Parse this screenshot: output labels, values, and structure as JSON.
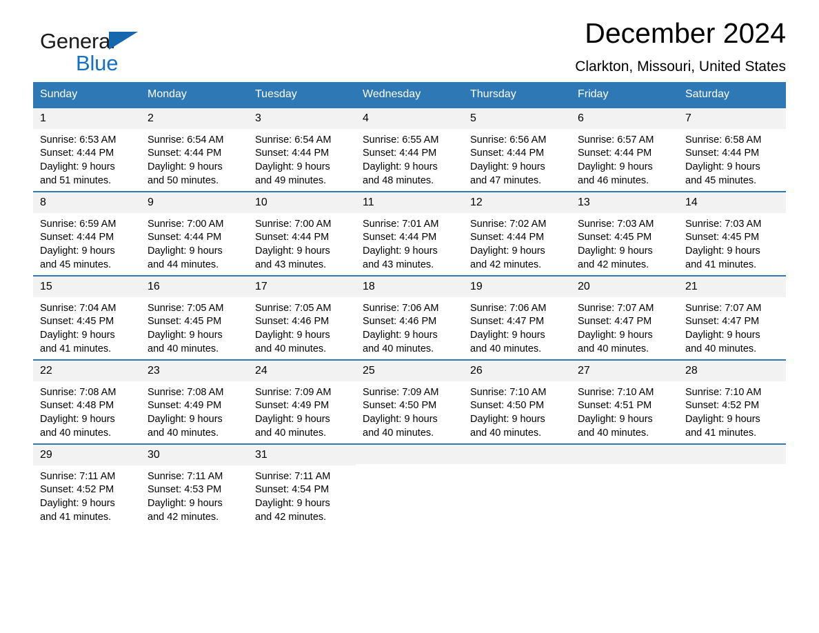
{
  "brand": {
    "name_part1": "General",
    "name_part2": "Blue",
    "accent_color": "#1271c4",
    "triangle_color": "#1567ae"
  },
  "header": {
    "title": "December 2024",
    "location": "Clarkton, Missouri, United States"
  },
  "theme": {
    "header_row_color": "#2e79b5",
    "daynum_band_color": "#f2f2f2",
    "text_color": "#000000"
  },
  "weekday_headers": [
    "Sunday",
    "Monday",
    "Tuesday",
    "Wednesday",
    "Thursday",
    "Friday",
    "Saturday"
  ],
  "weeks": [
    [
      {
        "day": "1",
        "sunrise": "Sunrise: 6:53 AM",
        "sunset": "Sunset: 4:44 PM",
        "daylight_line1": "Daylight: 9 hours",
        "daylight_line2": "and 51 minutes."
      },
      {
        "day": "2",
        "sunrise": "Sunrise: 6:54 AM",
        "sunset": "Sunset: 4:44 PM",
        "daylight_line1": "Daylight: 9 hours",
        "daylight_line2": "and 50 minutes."
      },
      {
        "day": "3",
        "sunrise": "Sunrise: 6:54 AM",
        "sunset": "Sunset: 4:44 PM",
        "daylight_line1": "Daylight: 9 hours",
        "daylight_line2": "and 49 minutes."
      },
      {
        "day": "4",
        "sunrise": "Sunrise: 6:55 AM",
        "sunset": "Sunset: 4:44 PM",
        "daylight_line1": "Daylight: 9 hours",
        "daylight_line2": "and 48 minutes."
      },
      {
        "day": "5",
        "sunrise": "Sunrise: 6:56 AM",
        "sunset": "Sunset: 4:44 PM",
        "daylight_line1": "Daylight: 9 hours",
        "daylight_line2": "and 47 minutes."
      },
      {
        "day": "6",
        "sunrise": "Sunrise: 6:57 AM",
        "sunset": "Sunset: 4:44 PM",
        "daylight_line1": "Daylight: 9 hours",
        "daylight_line2": "and 46 minutes."
      },
      {
        "day": "7",
        "sunrise": "Sunrise: 6:58 AM",
        "sunset": "Sunset: 4:44 PM",
        "daylight_line1": "Daylight: 9 hours",
        "daylight_line2": "and 45 minutes."
      }
    ],
    [
      {
        "day": "8",
        "sunrise": "Sunrise: 6:59 AM",
        "sunset": "Sunset: 4:44 PM",
        "daylight_line1": "Daylight: 9 hours",
        "daylight_line2": "and 45 minutes."
      },
      {
        "day": "9",
        "sunrise": "Sunrise: 7:00 AM",
        "sunset": "Sunset: 4:44 PM",
        "daylight_line1": "Daylight: 9 hours",
        "daylight_line2": "and 44 minutes."
      },
      {
        "day": "10",
        "sunrise": "Sunrise: 7:00 AM",
        "sunset": "Sunset: 4:44 PM",
        "daylight_line1": "Daylight: 9 hours",
        "daylight_line2": "and 43 minutes."
      },
      {
        "day": "11",
        "sunrise": "Sunrise: 7:01 AM",
        "sunset": "Sunset: 4:44 PM",
        "daylight_line1": "Daylight: 9 hours",
        "daylight_line2": "and 43 minutes."
      },
      {
        "day": "12",
        "sunrise": "Sunrise: 7:02 AM",
        "sunset": "Sunset: 4:44 PM",
        "daylight_line1": "Daylight: 9 hours",
        "daylight_line2": "and 42 minutes."
      },
      {
        "day": "13",
        "sunrise": "Sunrise: 7:03 AM",
        "sunset": "Sunset: 4:45 PM",
        "daylight_line1": "Daylight: 9 hours",
        "daylight_line2": "and 42 minutes."
      },
      {
        "day": "14",
        "sunrise": "Sunrise: 7:03 AM",
        "sunset": "Sunset: 4:45 PM",
        "daylight_line1": "Daylight: 9 hours",
        "daylight_line2": "and 41 minutes."
      }
    ],
    [
      {
        "day": "15",
        "sunrise": "Sunrise: 7:04 AM",
        "sunset": "Sunset: 4:45 PM",
        "daylight_line1": "Daylight: 9 hours",
        "daylight_line2": "and 41 minutes."
      },
      {
        "day": "16",
        "sunrise": "Sunrise: 7:05 AM",
        "sunset": "Sunset: 4:45 PM",
        "daylight_line1": "Daylight: 9 hours",
        "daylight_line2": "and 40 minutes."
      },
      {
        "day": "17",
        "sunrise": "Sunrise: 7:05 AM",
        "sunset": "Sunset: 4:46 PM",
        "daylight_line1": "Daylight: 9 hours",
        "daylight_line2": "and 40 minutes."
      },
      {
        "day": "18",
        "sunrise": "Sunrise: 7:06 AM",
        "sunset": "Sunset: 4:46 PM",
        "daylight_line1": "Daylight: 9 hours",
        "daylight_line2": "and 40 minutes."
      },
      {
        "day": "19",
        "sunrise": "Sunrise: 7:06 AM",
        "sunset": "Sunset: 4:47 PM",
        "daylight_line1": "Daylight: 9 hours",
        "daylight_line2": "and 40 minutes."
      },
      {
        "day": "20",
        "sunrise": "Sunrise: 7:07 AM",
        "sunset": "Sunset: 4:47 PM",
        "daylight_line1": "Daylight: 9 hours",
        "daylight_line2": "and 40 minutes."
      },
      {
        "day": "21",
        "sunrise": "Sunrise: 7:07 AM",
        "sunset": "Sunset: 4:47 PM",
        "daylight_line1": "Daylight: 9 hours",
        "daylight_line2": "and 40 minutes."
      }
    ],
    [
      {
        "day": "22",
        "sunrise": "Sunrise: 7:08 AM",
        "sunset": "Sunset: 4:48 PM",
        "daylight_line1": "Daylight: 9 hours",
        "daylight_line2": "and 40 minutes."
      },
      {
        "day": "23",
        "sunrise": "Sunrise: 7:08 AM",
        "sunset": "Sunset: 4:49 PM",
        "daylight_line1": "Daylight: 9 hours",
        "daylight_line2": "and 40 minutes."
      },
      {
        "day": "24",
        "sunrise": "Sunrise: 7:09 AM",
        "sunset": "Sunset: 4:49 PM",
        "daylight_line1": "Daylight: 9 hours",
        "daylight_line2": "and 40 minutes."
      },
      {
        "day": "25",
        "sunrise": "Sunrise: 7:09 AM",
        "sunset": "Sunset: 4:50 PM",
        "daylight_line1": "Daylight: 9 hours",
        "daylight_line2": "and 40 minutes."
      },
      {
        "day": "26",
        "sunrise": "Sunrise: 7:10 AM",
        "sunset": "Sunset: 4:50 PM",
        "daylight_line1": "Daylight: 9 hours",
        "daylight_line2": "and 40 minutes."
      },
      {
        "day": "27",
        "sunrise": "Sunrise: 7:10 AM",
        "sunset": "Sunset: 4:51 PM",
        "daylight_line1": "Daylight: 9 hours",
        "daylight_line2": "and 40 minutes."
      },
      {
        "day": "28",
        "sunrise": "Sunrise: 7:10 AM",
        "sunset": "Sunset: 4:52 PM",
        "daylight_line1": "Daylight: 9 hours",
        "daylight_line2": "and 41 minutes."
      }
    ],
    [
      {
        "day": "29",
        "sunrise": "Sunrise: 7:11 AM",
        "sunset": "Sunset: 4:52 PM",
        "daylight_line1": "Daylight: 9 hours",
        "daylight_line2": "and 41 minutes."
      },
      {
        "day": "30",
        "sunrise": "Sunrise: 7:11 AM",
        "sunset": "Sunset: 4:53 PM",
        "daylight_line1": "Daylight: 9 hours",
        "daylight_line2": "and 42 minutes."
      },
      {
        "day": "31",
        "sunrise": "Sunrise: 7:11 AM",
        "sunset": "Sunset: 4:54 PM",
        "daylight_line1": "Daylight: 9 hours",
        "daylight_line2": "and 42 minutes."
      },
      {
        "day": "",
        "sunrise": "",
        "sunset": "",
        "daylight_line1": "",
        "daylight_line2": ""
      },
      {
        "day": "",
        "sunrise": "",
        "sunset": "",
        "daylight_line1": "",
        "daylight_line2": ""
      },
      {
        "day": "",
        "sunrise": "",
        "sunset": "",
        "daylight_line1": "",
        "daylight_line2": ""
      },
      {
        "day": "",
        "sunrise": "",
        "sunset": "",
        "daylight_line1": "",
        "daylight_line2": ""
      }
    ]
  ]
}
